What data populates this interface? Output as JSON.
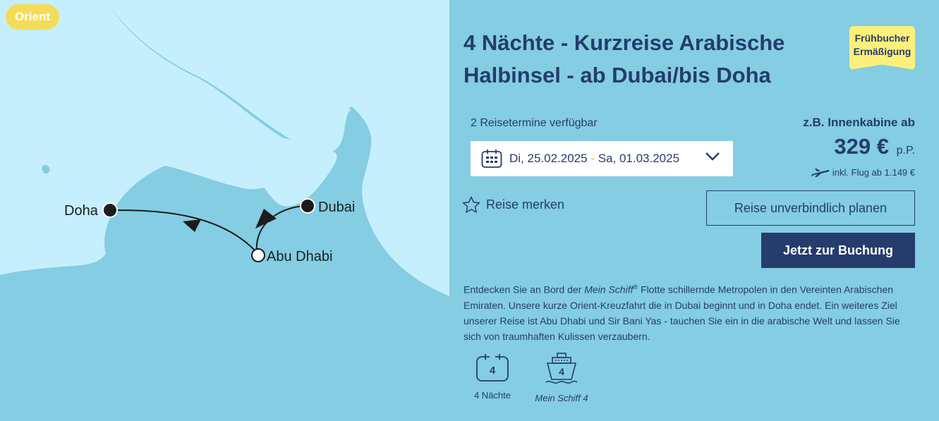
{
  "region_badge": "Orient",
  "map": {
    "ports": [
      "Doha",
      "Dubai",
      "Abu Dhabi"
    ]
  },
  "cruise": {
    "title": "4 Nächte - Kurzreise Arabische Halbinsel - ab Dubai/bis Doha",
    "promo_line1": "Frühbucher",
    "promo_line2": "Ermäßigung",
    "dates_available": "2 Reisetermine verfügbar",
    "date_start": "Di, 25.02.2025",
    "date_sep": " - ",
    "date_end": "Sa, 01.03.2025",
    "price_label": "z.B. Innenkabine ab",
    "price": "329 €",
    "price_unit": "p.P.",
    "flight_info": "inkl. Flug ab 1.149 €",
    "watch_label": "Reise merken",
    "plan_button": "Reise unverbindlich planen",
    "book_button": "Jetzt zur Buchung",
    "description": {
      "part1": "Entdecken Sie an Bord der ",
      "ship_italic": "Mein Schiff",
      "reg": "®",
      "part2": " Flotte schillernde Metropolen in den Vereinten Arabischen Emiraten. Unsere kurze Orient-Kreuzfahrt die in Dubai beginnt und in Doha endet. Ein weiteres Ziel unserer Reise ist Abu Dhabi und Sir Bani Yas - tauchen Sie ein in die arabische Welt und lassen Sie sich von traumhaften Kulissen verzaubern."
    },
    "features": [
      {
        "number": "4",
        "label": "4 Nächte"
      },
      {
        "number": "4",
        "label": "Mein Schiff 4"
      }
    ]
  },
  "colors": {
    "navy": "#253c6c",
    "panel_bg": "#84cde3",
    "sea": "#c6effd",
    "land": "#84cde3",
    "badge_yellow": "#f4dc58",
    "promo_yellow": "#fdf07a"
  }
}
